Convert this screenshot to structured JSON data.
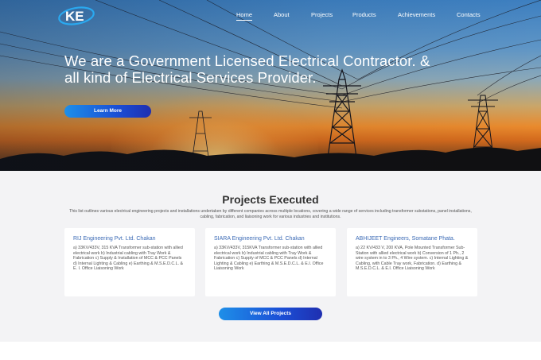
{
  "brand": {
    "logo_text": "KE",
    "accent": "#1b4fd6"
  },
  "nav": {
    "items": [
      "Home",
      "About",
      "Projects",
      "Products",
      "Achievements",
      "Contacts"
    ],
    "active": "Home"
  },
  "hero": {
    "title": "We are a Government Licensed Electrical Contractor. & all kind of Electrical Services Provider.",
    "cta": "Learn More"
  },
  "projects": {
    "title": "Projects Executed",
    "description": "This list outlines various electrical engineering projects and installations undertaken by different companies across multiple locations, covering a wide range of services including transformer substations, panel installations, cabling, fabrication, and liaisoning work for various industries and institutions.",
    "cards": [
      {
        "title": "RIJ Engineering Pvt. Ltd. Chakan",
        "body": "a) 33KV/433V, 315 KVA Transformer sub-station with allied electrical work b) Industrial cabling with Tray Work & Fabrication c) Supply & Installation of MCC & PCC Panels d) Internal Lighting & Cabling e) Earthing & M.S.E.D.C.L. & E. I. Office Liaisoning Work"
      },
      {
        "title": "SIARA Engineering Pvt. Ltd. Chakan",
        "body": "a) 33KV/433V, 315KVA Transformer sub-station with allied electrical work b) Industrial cabling with Tray Work & Fabrication c) Supply of MCC & PCC Panels d) Internal Lighting & Cabling e) Earthing & M.S.E.D.C.L. & E.I. Office Liaisoning Work"
      },
      {
        "title": "ABHIJEET Engineers, Somatane Phata.",
        "body": "a) 22 KV/433 V, 200 KVA, Pole Mounted Transformer Sub-Station with allied electrical work b) Conversion of 1 Ph., 2 wire system in to 3 Ph., 4 Wire system. c) Internal Lighting & Cabling, with Cable Tray work, Fabrication. d) Earthing & M.S.E.D.C.L. & E.I. Office Liaisoning Work"
      }
    ],
    "cta": "View All Projects"
  }
}
